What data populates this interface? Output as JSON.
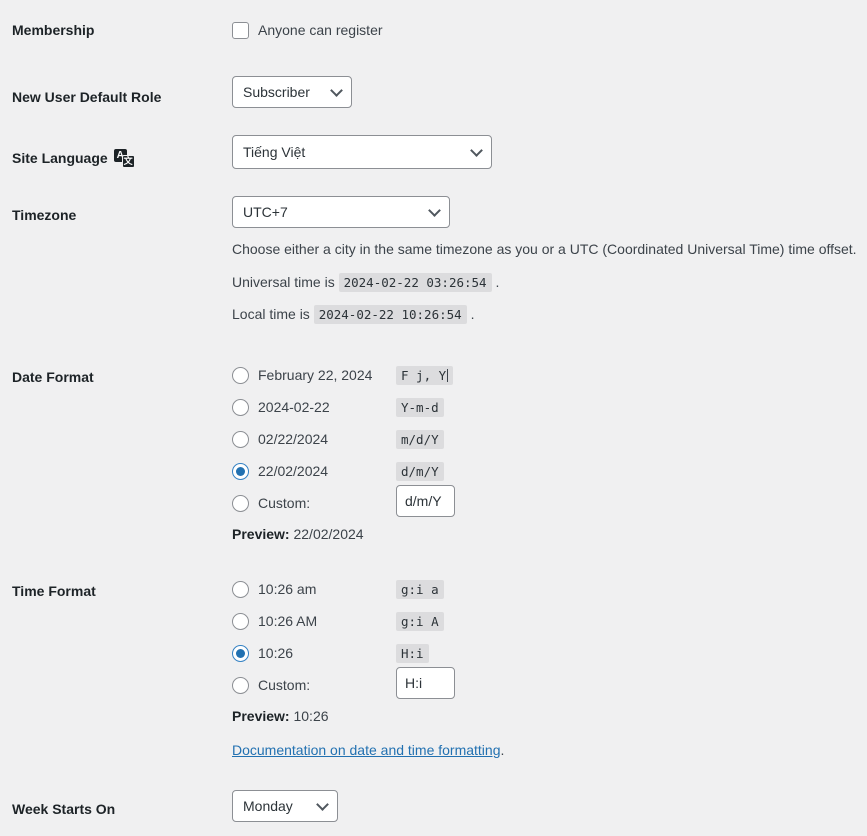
{
  "membership": {
    "label": "Membership",
    "checkbox_label": "Anyone can register",
    "checked": false
  },
  "new_user_default_role": {
    "label": "New User Default Role",
    "value": "Subscriber"
  },
  "site_language": {
    "label": "Site Language",
    "icon": "translate-icon",
    "icon_glyph_primary": "A",
    "icon_glyph_secondary": "文",
    "value": "Tiếng Việt"
  },
  "timezone": {
    "label": "Timezone",
    "value": "UTC+7",
    "description": "Choose either a city in the same timezone as you or a UTC (Coordinated Universal Time) time offset.",
    "universal_time_prefix": "Universal time is",
    "universal_time_value": "2024-02-22 03:26:54",
    "universal_time_suffix": ".",
    "local_time_prefix": "Local time is",
    "local_time_value": "2024-02-22 10:26:54",
    "local_time_suffix": "."
  },
  "date_format": {
    "label": "Date Format",
    "options": [
      {
        "sample": "February 22, 2024",
        "code": "F j, Y",
        "selected": false
      },
      {
        "sample": "2024-02-22",
        "code": "Y-m-d",
        "selected": false
      },
      {
        "sample": "02/22/2024",
        "code": "m/d/Y",
        "selected": false
      },
      {
        "sample": "22/02/2024",
        "code": "d/m/Y",
        "selected": true
      }
    ],
    "custom_label": "Custom:",
    "custom_selected": false,
    "custom_value": "d/m/Y",
    "preview_label": "Preview:",
    "preview_value": "22/02/2024"
  },
  "time_format": {
    "label": "Time Format",
    "options": [
      {
        "sample": "10:26 am",
        "code": "g:i a",
        "selected": false
      },
      {
        "sample": "10:26 AM",
        "code": "g:i A",
        "selected": false
      },
      {
        "sample": "10:26",
        "code": "H:i",
        "selected": true
      }
    ],
    "custom_label": "Custom:",
    "custom_selected": false,
    "custom_value": "H:i",
    "preview_label": "Preview:",
    "preview_value": "10:26",
    "doc_link_text": "Documentation on date and time formatting",
    "doc_link_suffix": "."
  },
  "week_starts_on": {
    "label": "Week Starts On",
    "value": "Monday"
  },
  "colors": {
    "page_background": "#f0f0f1",
    "accent": "#2271b1",
    "label_text": "#1d2327",
    "body_text": "#3c434a",
    "border": "#8c8f94",
    "code_chip_background": "#dcdcde"
  }
}
